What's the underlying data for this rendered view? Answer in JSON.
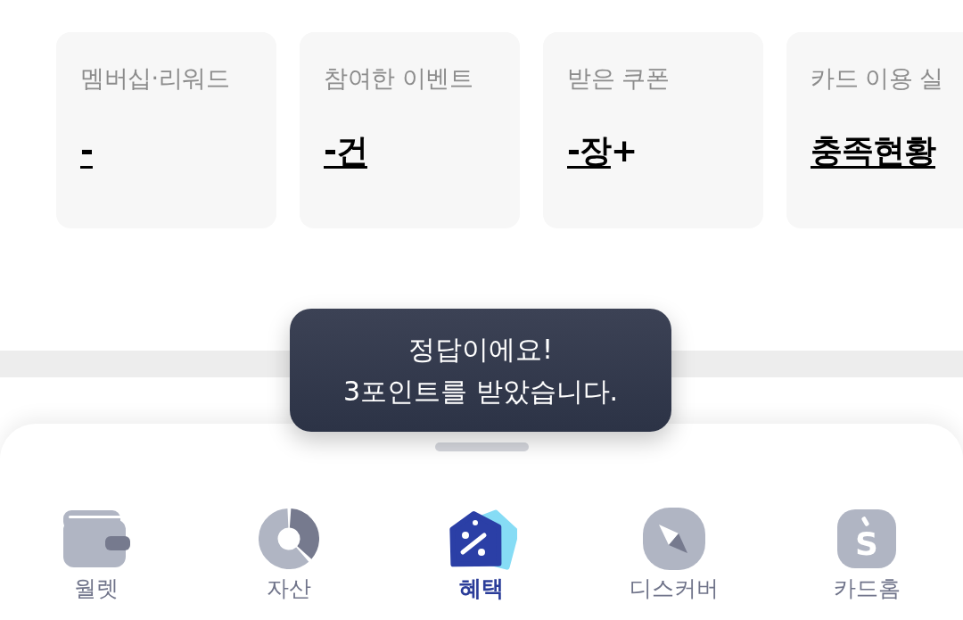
{
  "summary_cards": [
    {
      "label": "멤버십·리워드",
      "value": "-"
    },
    {
      "label": "참여한 이벤트",
      "value": "-건"
    },
    {
      "label": "받은 쿠폰",
      "value": "-장",
      "suffix": "+"
    },
    {
      "label": "카드 이용 실",
      "value": "충족현황"
    }
  ],
  "toast": {
    "lines": [
      "정답이에요!",
      "3포인트를 받았습니다."
    ]
  },
  "bottom_nav": {
    "items": [
      {
        "label": "월렛",
        "selected": false
      },
      {
        "label": "자산",
        "selected": false
      },
      {
        "label": "혜택",
        "selected": true
      },
      {
        "label": "디스커버",
        "selected": false
      },
      {
        "label": "카드홈",
        "selected": false,
        "icon_letter": "S"
      }
    ]
  }
}
